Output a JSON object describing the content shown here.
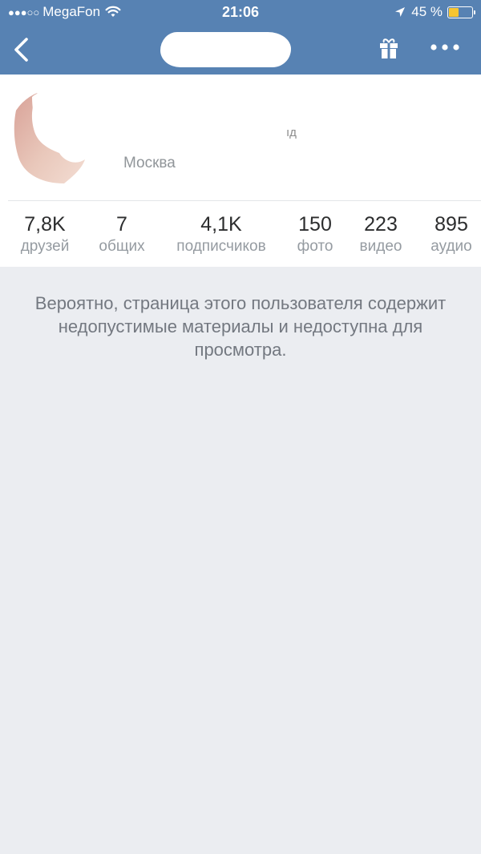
{
  "status_bar": {
    "carrier": "MegaFon",
    "time": "21:06",
    "battery_percent": "45 %",
    "battery_level": 0.45,
    "signal_bars": 3
  },
  "nav": {
    "back_icon": "chevron-left-icon",
    "gift_icon": "gift-icon",
    "more_icon": "more-dots-icon",
    "name_hidden": true
  },
  "profile": {
    "status_fragment": "ıд",
    "city": "Москва"
  },
  "stats": [
    {
      "value": "7,8K",
      "label": "друзей"
    },
    {
      "value": "7",
      "label": "общих"
    },
    {
      "value": "4,1K",
      "label": "подписчиков"
    },
    {
      "value": "150",
      "label": "фото"
    },
    {
      "value": "223",
      "label": "видео"
    },
    {
      "value": "895",
      "label": "аудио"
    }
  ],
  "notice": "Вероятно, страница этого пользователя содержит недопустимые материалы и недоступна для просмотра.",
  "colors": {
    "header": "#5782b3",
    "background": "#ebedf1",
    "battery": "#f7c531"
  }
}
